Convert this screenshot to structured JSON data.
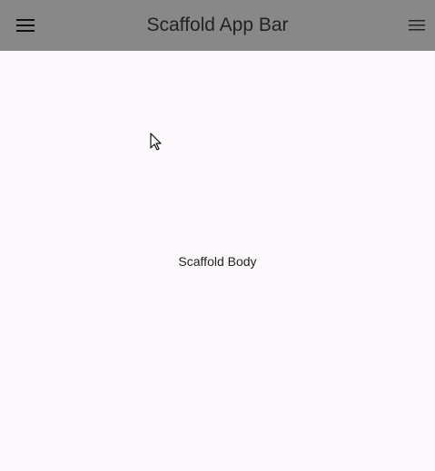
{
  "app_bar": {
    "title": "Scaffold App Bar",
    "leading_icon": "hamburger-menu-icon",
    "trailing_icon": "overflow-menu-icon",
    "background": "#888888",
    "title_color": "#222222"
  },
  "body": {
    "text": "Scaffold Body",
    "background": "#fdf8fc"
  },
  "cursor": {
    "icon": "mouse-pointer-icon"
  }
}
